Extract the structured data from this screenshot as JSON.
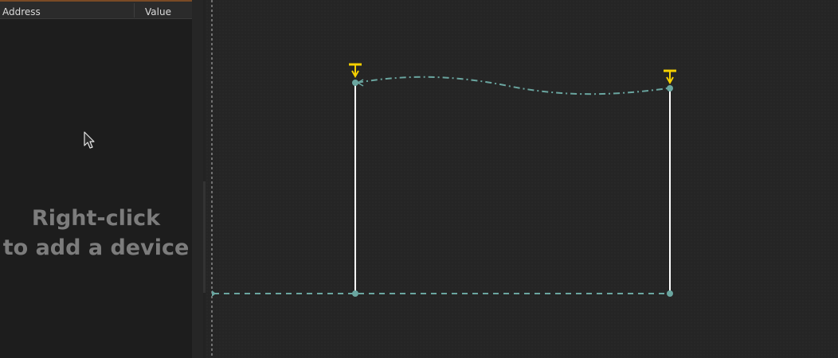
{
  "device_list": {
    "columns": {
      "address": "Address",
      "value": "Value"
    },
    "empty_hint": {
      "line1": "Right-click",
      "line2": "to add a device"
    }
  },
  "canvas": {
    "wire_color": "#ffffff",
    "signal_color": "#6aa6a0",
    "power_symbol_color": "#f5d000",
    "icons": [
      "power-symbol-icon",
      "mouse-pointer-icon"
    ]
  }
}
